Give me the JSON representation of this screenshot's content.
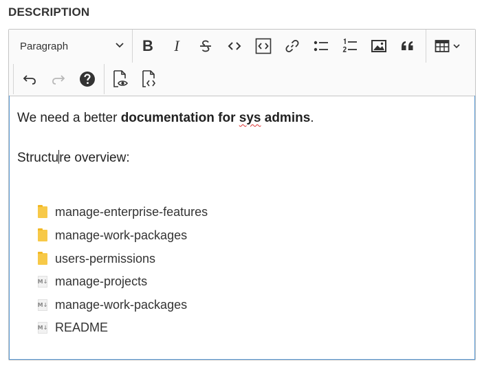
{
  "section": {
    "label": "DESCRIPTION"
  },
  "toolbar": {
    "heading_select": {
      "value": "Paragraph",
      "icon": "chevron-down-icon"
    },
    "buttons": {
      "bold": "B",
      "italic": "I"
    }
  },
  "content": {
    "line1_plain": "We need a better ",
    "line1_bold_a": "documentation for ",
    "line1_bold_misspelled": "sys",
    "line1_bold_b": " admins",
    "line1_end": ".",
    "line2_before_caret": "Structu",
    "line2_after_caret": "re overview:",
    "tree": [
      {
        "type": "folder",
        "name": "manage-enterprise-features"
      },
      {
        "type": "folder",
        "name": "manage-work-packages"
      },
      {
        "type": "folder",
        "name": "users-permissions"
      },
      {
        "type": "markdown",
        "name": "manage-projects",
        "badge": "M↓"
      },
      {
        "type": "markdown",
        "name": "manage-work-packages",
        "badge": "M↓"
      },
      {
        "type": "markdown",
        "name": "README",
        "badge": "M↓"
      }
    ]
  },
  "colors": {
    "focus_border": "#5b9bd5",
    "toolbar_bg": "#fafafa",
    "folder": "#f7c948",
    "spellcheck": "#dd3333"
  }
}
